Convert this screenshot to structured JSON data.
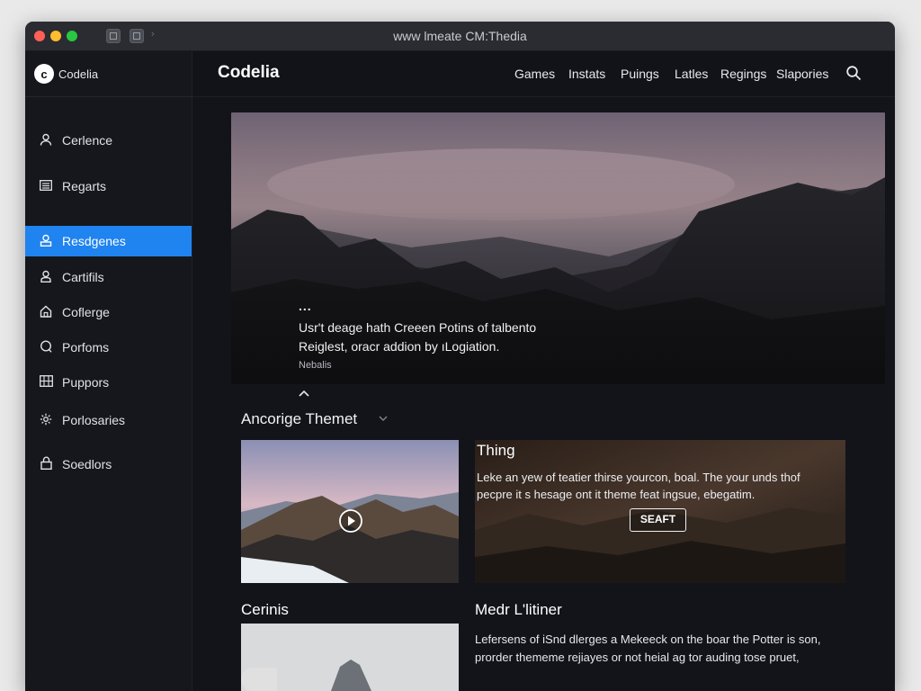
{
  "window": {
    "title": "www lmeate CM:Thedia"
  },
  "sidebar": {
    "brand": {
      "logo_letter": "c",
      "name": "Codelia"
    },
    "items": [
      {
        "label": "Cerlence",
        "icon": "user-icon",
        "active": false
      },
      {
        "label": "Regarts",
        "icon": "list-icon",
        "active": false
      },
      {
        "label": "Resdgenes",
        "icon": "person-badge-icon",
        "active": true
      },
      {
        "label": "Cartifils",
        "icon": "person-icon",
        "active": false
      },
      {
        "label": "Coflerge",
        "icon": "home-icon",
        "active": false
      },
      {
        "label": "Porfoms",
        "icon": "chat-icon",
        "active": false
      },
      {
        "label": "Puppors",
        "icon": "grid-icon",
        "active": false
      },
      {
        "label": "Porlosaries",
        "icon": "gear-icon",
        "active": false
      },
      {
        "label": "Soedlors",
        "icon": "lock-icon",
        "active": false
      }
    ]
  },
  "header": {
    "site_title": "Codelia",
    "nav": [
      "Games",
      "Instats",
      "Puings",
      "Latles",
      "Regings",
      "Slapories"
    ],
    "search_icon": "search-icon"
  },
  "hero": {
    "dots": "...",
    "line1": "Usr't deage hath Creeen Potins of talbento",
    "line2": "Reiglest, oracr addion by ıLogiation.",
    "meta": "Nebalis"
  },
  "section": {
    "title": "Ancorige Themet"
  },
  "card2": {
    "title": "Thing",
    "body": "Leke an yew of teatier thirse yourcon, boal. The your unds thof pecpre it s hesage ont it theme feat ingsue, ebegatim.",
    "button": "SEAFT"
  },
  "row3": {
    "left_title": "Cerinis",
    "right_title": "Medr L'litiner",
    "right_body": "Lefersens of iSnd dlerges a Mekeeck on the boar the Potter is son, prorder thememe rejiayes or not heial ag tor auding tose pruet,"
  },
  "colors": {
    "accent": "#1f83f0",
    "window_bg": "#121419",
    "sidebar_bg": "#15171c"
  }
}
